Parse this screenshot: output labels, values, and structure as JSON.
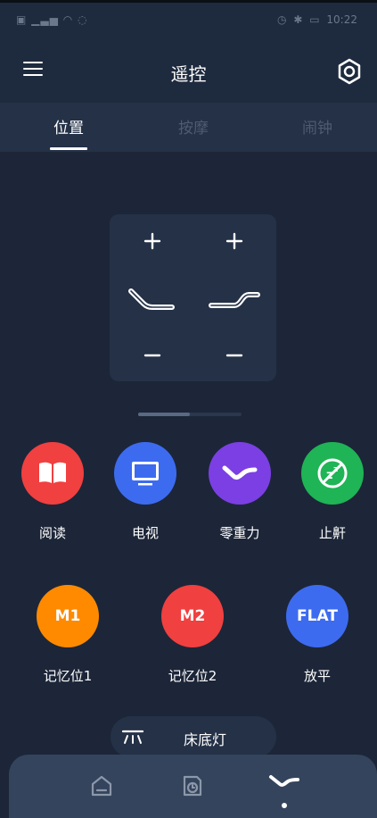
{
  "status_bar": {
    "left_icons": [
      "sim-icon",
      "signal-icon",
      "wifi-icon",
      "hotspot-icon"
    ],
    "right_icons": [
      "alarm-icon",
      "bluetooth-icon",
      "battery-icon"
    ],
    "time": "10:22"
  },
  "header": {
    "title": "遥控",
    "menu_icon": "hamburger-icon",
    "settings_icon": "hex-settings-icon"
  },
  "tabs": [
    {
      "label": "位置",
      "active": true
    },
    {
      "label": "按摩",
      "active": false
    },
    {
      "label": "闹钟",
      "active": false
    }
  ],
  "position_control": {
    "head_plus": "+",
    "head_minus": "−",
    "foot_plus": "+",
    "foot_minus": "−",
    "head_icon": "head-lift-icon",
    "foot_icon": "foot-lift-icon"
  },
  "pager": {
    "pages": 2,
    "current": 1
  },
  "modes": [
    {
      "label": "阅读",
      "icon": "book-icon",
      "color": "#f04040"
    },
    {
      "label": "电视",
      "icon": "tv-icon",
      "color": "#3d6bf0"
    },
    {
      "label": "零重力",
      "icon": "zero-gravity-icon",
      "color": "#7b3fe4"
    },
    {
      "label": "止鼾",
      "icon": "anti-snore-icon",
      "color": "#1fb455"
    }
  ],
  "memory": [
    {
      "badge": "M1",
      "label": "记忆位1",
      "color": "#ff8a00"
    },
    {
      "badge": "M2",
      "label": "记忆位2",
      "color": "#f04040"
    },
    {
      "badge": "FLAT",
      "label": "放平",
      "color": "#3d6bf0"
    }
  ],
  "underbed_light": {
    "label": "床底灯",
    "icon": "underbed-light-icon"
  },
  "bottom_nav": [
    {
      "icon": "home-icon",
      "active": false
    },
    {
      "icon": "timer-icon",
      "active": false
    },
    {
      "icon": "bed-icon",
      "active": true
    }
  ],
  "colors": {
    "background": "#1c2638",
    "header": "#1e2a3d",
    "panel": "#243147",
    "nav": "#34445d"
  }
}
